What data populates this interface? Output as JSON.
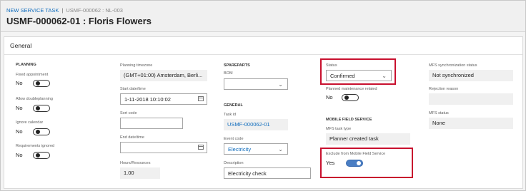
{
  "header": {
    "breadcrumb_link": "NEW SERVICE TASK",
    "breadcrumb_sep": "|",
    "breadcrumb_id": "USMF-000062 : NL-003",
    "title": "USMF-000062-01 : Floris Flowers"
  },
  "section": {
    "title": "General"
  },
  "planning": {
    "group": "PLANNING",
    "fixed_appointment_label": "Fixed appointment",
    "fixed_appointment_value": "No",
    "allow_doubleplanning_label": "Allow doubleplanning",
    "allow_doubleplanning_value": "No",
    "ignore_calendar_label": "Ignore calendar",
    "ignore_calendar_value": "No",
    "requirements_ignored_label": "Requirements ignored",
    "requirements_ignored_value": "No"
  },
  "timing": {
    "timezone_label": "Planning timezone",
    "timezone_value": "(GMT+01:00) Amsterdam, Berli...",
    "start_label": "Start date/time",
    "start_value": "1-11-2018 10:10:02",
    "sort_label": "Sort code",
    "sort_value": "",
    "end_label": "End date/time",
    "end_value": "",
    "hours_label": "Hours/Resources",
    "hours_value": "1.00"
  },
  "spareparts": {
    "group": "SPAREPARTS",
    "bom_label": "BOM",
    "bom_value": ""
  },
  "general": {
    "group": "GENERAL",
    "task_id_label": "Task id",
    "task_id_value": "USMF-000062-01",
    "event_code_label": "Event code",
    "event_code_value": "Electricity",
    "description_label": "Description",
    "description_value": "Electricity check"
  },
  "status": {
    "label": "Status",
    "value": "Confirmed",
    "planned_maint_label": "Planned maintenance related",
    "planned_maint_value": "No"
  },
  "mfs": {
    "group": "MOBILE FIELD SERVICE",
    "task_type_label": "MFS task type",
    "task_type_value": "Planner created task",
    "exclude_label": "Exclude from Mobile Field Service",
    "exclude_value": "Yes"
  },
  "sync": {
    "sync_label": "MFS synchronization status",
    "sync_value": "Not synchronized",
    "rejection_label": "Rejection reason",
    "rejection_value": "",
    "mfs_status_label": "MFS status",
    "mfs_status_value": "None"
  },
  "colors": {
    "highlight": "#c8102e",
    "link": "#0f6cbd",
    "toggle_on": "#4a7ec4"
  },
  "icons": {
    "dropdown": "chevron-down-icon",
    "calendar": "calendar-icon"
  }
}
